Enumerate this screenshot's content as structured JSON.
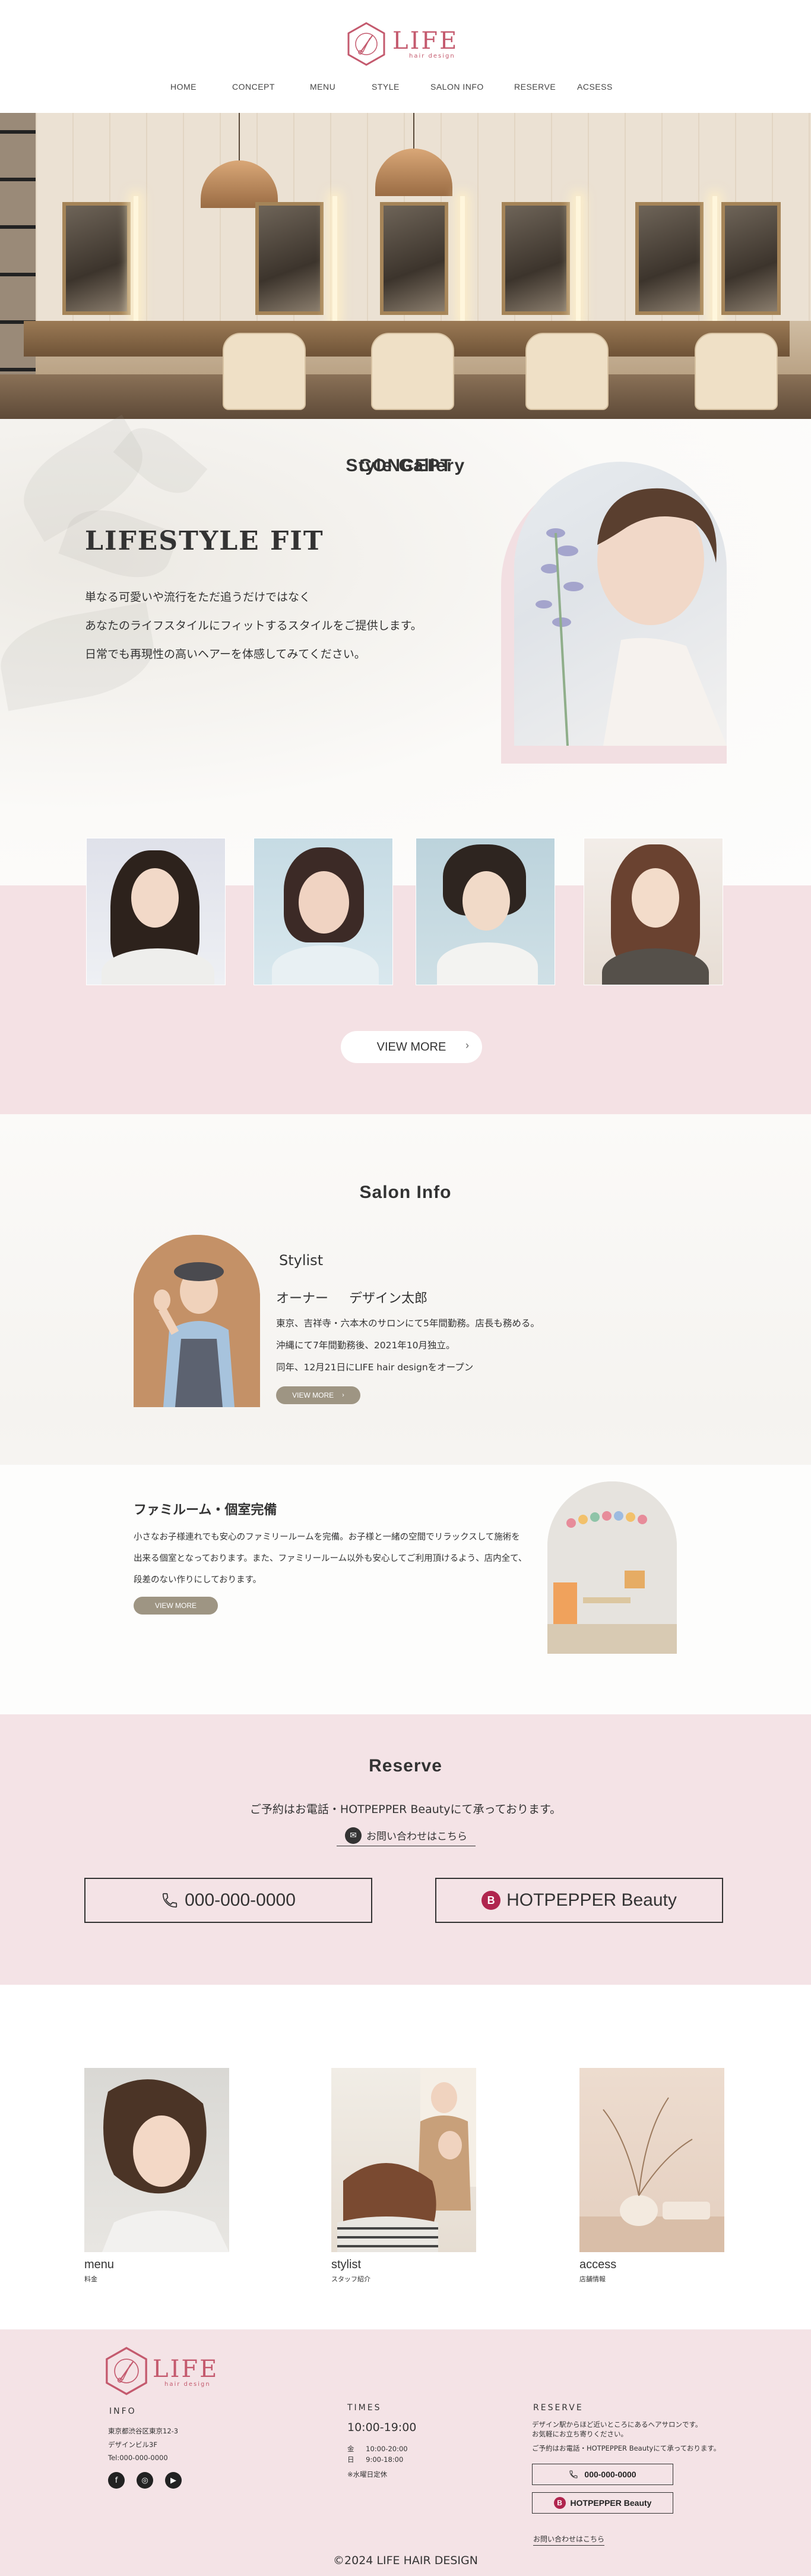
{
  "brand": {
    "name": "LIFE",
    "tagline": "hair design",
    "accent_color": "#c45a6e",
    "pink_bg": "#f4e1e4"
  },
  "nav": {
    "items": [
      "HOME",
      "CONCEPT",
      "MENU",
      "STYLE",
      "SALON INFO",
      "RESERVE",
      "ACSESS"
    ]
  },
  "concept": {
    "heading": "CONCEPT",
    "title": "LIFESTYLE FIT",
    "lines": [
      "単なる可愛いや流行をただ追うだけではなく",
      "あなたのライフスタイルにフィットするスタイルをご提供します。",
      "日常でも再現性の高いヘアーを体感してみてください。"
    ]
  },
  "gallery": {
    "heading": "Style Gallery",
    "view_more": "VIEW MORE",
    "chevron_icon": "chevron-right-icon"
  },
  "salon": {
    "heading": "Salon Info",
    "stylist_label": "Stylist",
    "owner_role": "オーナー",
    "owner_name": "デザイン太郎",
    "bio": [
      "東京、吉祥寺・六本木のサロンにて5年間勤務。店長も務める。",
      "沖縄にて7年間勤務後、2021年10月独立。",
      "同年、12月21日にLIFE hair designをオープン"
    ],
    "view_more": "VIEW MORE",
    "family": {
      "title": "ファミルーム・個室完備",
      "lines": [
        "小さなお子様連れでも安心のファミリールームを完備。お子様と一緒の空間でリラックスして施術を",
        "出来る個室となっております。また、ファミリールーム以外も安心してご利用頂けるよう、店内全て、",
        "段差のない作りにしております。"
      ],
      "view_more": "VIEW MORE"
    }
  },
  "reserve": {
    "heading": "Reserve",
    "note": "ご予約はお電話・HOTPEPPER Beautyにて承っております。",
    "contact_label": "お問い合わせはこちら",
    "phone": "000-000-0000",
    "hotpepper": "HOTPEPPER Beauty",
    "hotpepper_badge": "B"
  },
  "cards": [
    {
      "title": "menu",
      "sub": "料金"
    },
    {
      "title": "stylist",
      "sub": "スタッフ紹介"
    },
    {
      "title": "access",
      "sub": "店舗情報"
    }
  ],
  "footer": {
    "info_head": "INFO",
    "address": [
      "東京都渋谷区東京12-3",
      "デザインビル3F",
      "Tel:000-000-0000"
    ],
    "times_head": "TIMES",
    "times": "10:00-19:00",
    "time_rows": [
      {
        "day": "金",
        "time": "10:00-20:00"
      },
      {
        "day": "日",
        "time": "9:00-18:00"
      }
    ],
    "closed": "※水曜日定休",
    "reserve_head": "RESERVE",
    "reserve_lines": [
      "デザイン駅からほど近いところにあるヘアサロンです。",
      "お気軽にお立ち寄りください。",
      "ご予約はお電話・HOTPEPPER Beautyにて承っております。"
    ],
    "phone": "000-000-0000",
    "hotpepper": "HOTPEPPER Beauty",
    "hotpepper_badge": "B",
    "contact_link": "お問い合わせはこちら",
    "copyright": "©2024 LIFE HAIR DESIGN",
    "sns_icons": [
      "facebook-icon",
      "instagram-icon",
      "youtube-icon"
    ]
  }
}
